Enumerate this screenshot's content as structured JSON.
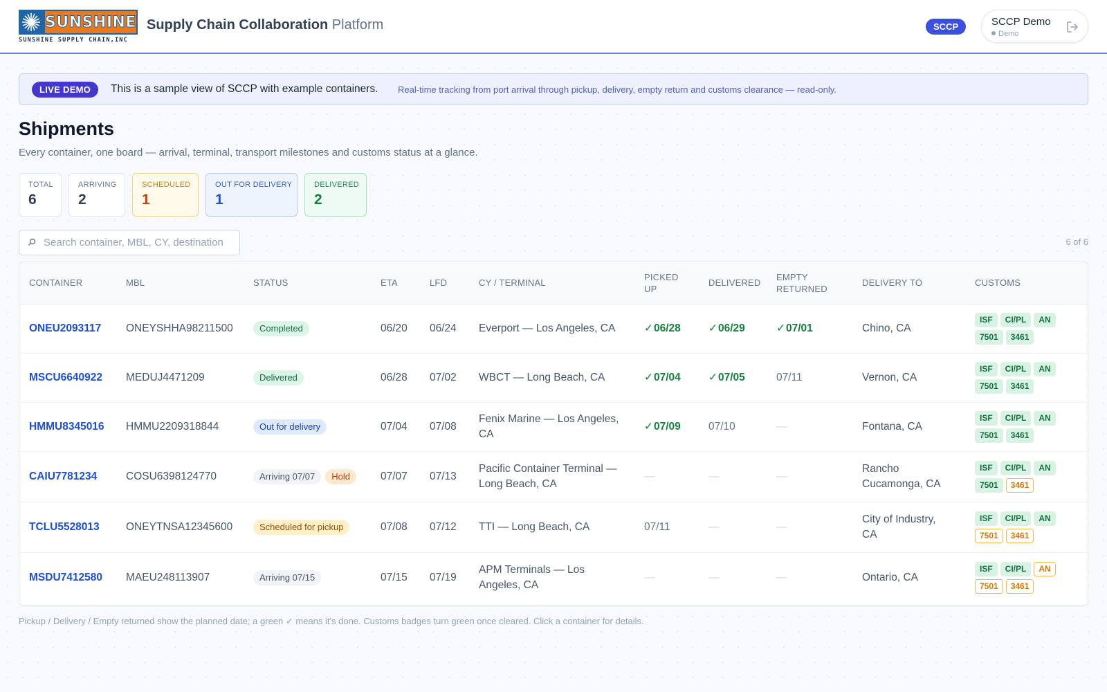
{
  "header": {
    "logo_text": "SUNSHINE",
    "logo_subtitle": "SUNSHINE SUPPLY CHAIN,INC",
    "title_strong": "Supply Chain Collaboration",
    "title_muted": "Platform",
    "env_badge": "SCCP",
    "user_name": "SCCP Demo",
    "user_role": "Demo"
  },
  "banner": {
    "pill": "LIVE DEMO",
    "message": "This is a sample view of SCCP with example containers.",
    "detail": "Real-time tracking from port arrival through pickup, delivery, empty return and customs clearance — read-only."
  },
  "page": {
    "title": "Shipments",
    "subtitle": "Every container, one board — arrival, terminal, transport milestones and customs status at a glance."
  },
  "stats": [
    {
      "label": "TOTAL",
      "value": "6"
    },
    {
      "label": "ARRIVING",
      "value": "2"
    },
    {
      "label": "SCHEDULED",
      "value": "1"
    },
    {
      "label": "OUT FOR DELIVERY",
      "value": "1"
    },
    {
      "label": "DELIVERED",
      "value": "2"
    }
  ],
  "search": {
    "placeholder": "Search container, MBL, CY, destination",
    "value": ""
  },
  "result_count": "6 of 6",
  "table": {
    "headers": {
      "container": "CONTAINER",
      "mbl": "MBL",
      "status": "STATUS",
      "eta": "ETA",
      "lfd": "LFD",
      "terminal": "CY / TERMINAL",
      "picked_up": "PICKED UP",
      "delivered": "DELIVERED",
      "empty_returned": "EMPTY RETURNED",
      "delivery_to": "DELIVERY TO",
      "customs": "CUSTOMS"
    },
    "check_mark": "✓",
    "dash": "—",
    "rows": [
      {
        "container": "ONEU2093117",
        "mbl": "ONEYSHHA98211500",
        "status": "Completed",
        "hold": "",
        "eta": "06/20",
        "lfd": "06/24",
        "terminal": "Everport — Los Angeles, CA",
        "picked_up": "06/28",
        "delivered": "06/29",
        "empty_returned": "07/01",
        "delivery_to": "Chino, CA",
        "customs": {
          "isf": "ISF",
          "cipl": "CI/PL",
          "an": "AN",
          "c7501": "7501",
          "c3461": "3461"
        }
      },
      {
        "container": "MSCU6640922",
        "mbl": "MEDUJ4471209",
        "status": "Delivered",
        "hold": "",
        "eta": "06/28",
        "lfd": "07/02",
        "terminal": "WBCT — Long Beach, CA",
        "picked_up": "07/04",
        "delivered": "07/05",
        "empty_returned": "07/11",
        "delivery_to": "Vernon, CA",
        "customs": {
          "isf": "ISF",
          "cipl": "CI/PL",
          "an": "AN",
          "c7501": "7501",
          "c3461": "3461"
        }
      },
      {
        "container": "HMMU8345016",
        "mbl": "HMMU2209318844",
        "status": "Out for delivery",
        "hold": "",
        "eta": "07/04",
        "lfd": "07/08",
        "terminal": "Fenix Marine — Los Angeles, CA",
        "picked_up": "07/09",
        "delivered": "07/10",
        "empty_returned": "—",
        "delivery_to": "Fontana, CA",
        "customs": {
          "isf": "ISF",
          "cipl": "CI/PL",
          "an": "AN",
          "c7501": "7501",
          "c3461": "3461"
        }
      },
      {
        "container": "CAIU7781234",
        "mbl": "COSU6398124770",
        "status": "Arriving 07/07",
        "hold": "Hold",
        "eta": "07/07",
        "lfd": "07/13",
        "terminal": "Pacific Container Terminal — Long Beach, CA",
        "picked_up": "—",
        "delivered": "—",
        "empty_returned": "—",
        "delivery_to": "Rancho Cucamonga, CA",
        "customs": {
          "isf": "ISF",
          "cipl": "CI/PL",
          "an": "AN",
          "c7501": "7501",
          "c3461": "3461"
        }
      },
      {
        "container": "TCLU5528013",
        "mbl": "ONEYTNSA12345600",
        "status": "Scheduled for pickup",
        "hold": "",
        "eta": "07/08",
        "lfd": "07/12",
        "terminal": "TTI — Long Beach, CA",
        "picked_up": "07/11",
        "delivered": "—",
        "empty_returned": "—",
        "delivery_to": "City of Industry, CA",
        "customs": {
          "isf": "ISF",
          "cipl": "CI/PL",
          "an": "AN",
          "c7501": "7501",
          "c3461": "3461"
        }
      },
      {
        "container": "MSDU7412580",
        "mbl": "MAEU248113907",
        "status": "Arriving 07/15",
        "hold": "",
        "eta": "07/15",
        "lfd": "07/19",
        "terminal": "APM Terminals — Los Angeles, CA",
        "picked_up": "—",
        "delivered": "—",
        "empty_returned": "—",
        "delivery_to": "Ontario, CA",
        "customs": {
          "isf": "ISF",
          "cipl": "CI/PL",
          "an": "AN",
          "c7501": "7501",
          "c3461": "3461"
        }
      }
    ]
  },
  "footnote": "Pickup / Delivery / Empty returned show the planned date; a green ✓ means it's done. Customs badges turn green once cleared. Click a container for details.",
  "colors": {
    "accent": "#3b4fe0",
    "link": "#1d4ed8",
    "done_green": "#15803d",
    "pending_orange": "#d97706"
  }
}
